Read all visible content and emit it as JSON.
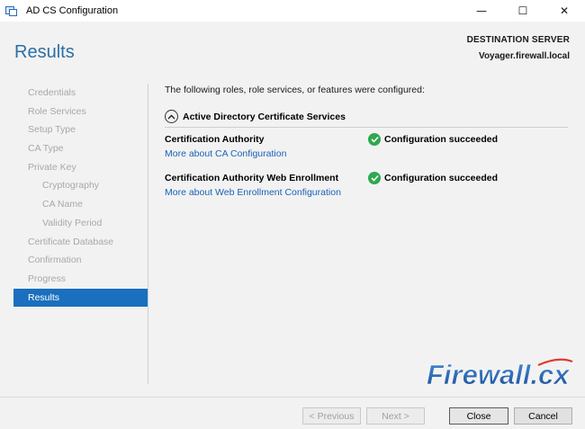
{
  "window": {
    "title": "AD CS Configuration",
    "controls": {
      "minimize": "—",
      "maximize": "☐",
      "close": "✕"
    }
  },
  "header": {
    "page_title": "Results",
    "destination_label": "DESTINATION SERVER",
    "destination_server": "Voyager.firewall.local"
  },
  "nav": {
    "items": [
      {
        "label": "Credentials",
        "level": 0,
        "state": "disabled"
      },
      {
        "label": "Role Services",
        "level": 0,
        "state": "disabled"
      },
      {
        "label": "Setup Type",
        "level": 0,
        "state": "disabled"
      },
      {
        "label": "CA Type",
        "level": 0,
        "state": "disabled"
      },
      {
        "label": "Private Key",
        "level": 0,
        "state": "disabled"
      },
      {
        "label": "Cryptography",
        "level": 1,
        "state": "disabled"
      },
      {
        "label": "CA Name",
        "level": 1,
        "state": "disabled"
      },
      {
        "label": "Validity Period",
        "level": 1,
        "state": "disabled"
      },
      {
        "label": "Certificate Database",
        "level": 0,
        "state": "disabled"
      },
      {
        "label": "Confirmation",
        "level": 0,
        "state": "disabled"
      },
      {
        "label": "Progress",
        "level": 0,
        "state": "disabled"
      },
      {
        "label": "Results",
        "level": 0,
        "state": "active"
      }
    ]
  },
  "main": {
    "intro": "The following roles, role services, or features were configured:",
    "section_title": "Active Directory Certificate Services",
    "results": [
      {
        "name": "Certification Authority",
        "link": "More about CA Configuration",
        "status": "Configuration succeeded"
      },
      {
        "name": "Certification Authority Web Enrollment",
        "link": "More about Web Enrollment Configuration",
        "status": "Configuration succeeded"
      }
    ]
  },
  "watermark": {
    "text": "Firewall.cx"
  },
  "footer": {
    "previous": "< Previous",
    "next": "Next >",
    "close": "Close",
    "cancel": "Cancel"
  },
  "colors": {
    "accent": "#1a6fbe",
    "title": "#2b6fa6",
    "link": "#1a62b8",
    "success": "#2fa84f"
  }
}
